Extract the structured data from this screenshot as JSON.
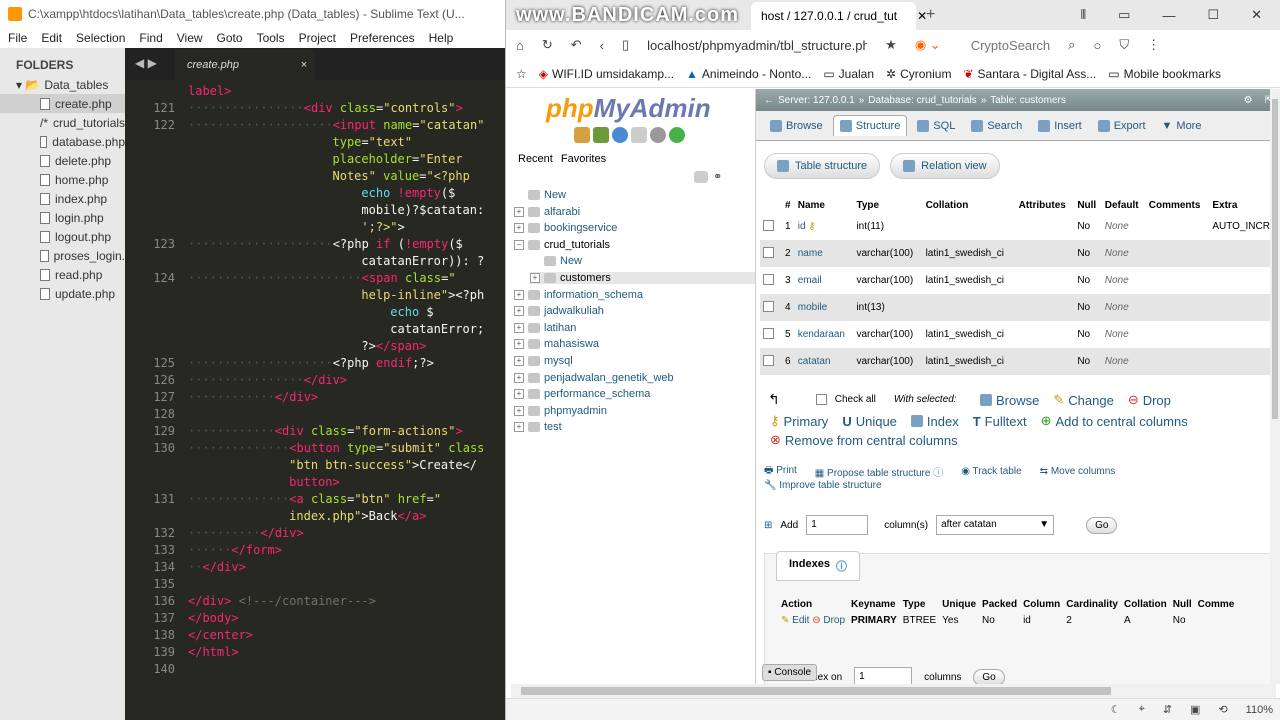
{
  "sublime": {
    "title": "C:\\xampp\\htdocs\\latihan\\Data_tables\\create.php (Data_tables) - Sublime Text (U...",
    "menu": [
      "File",
      "Edit",
      "Selection",
      "Find",
      "View",
      "Goto",
      "Tools",
      "Project",
      "Preferences",
      "Help"
    ],
    "folders_header": "FOLDERS",
    "root_folder": "Data_tables",
    "files": [
      "create.php",
      "crud_tutorials",
      "database.php",
      "delete.php",
      "home.php",
      "index.php",
      "login.php",
      "logout.php",
      "proses_login.",
      "read.php",
      "update.php"
    ],
    "tab_name": "create.php",
    "tab_close": "×",
    "code": [
      {
        "n": "",
        "t": "<span class=tg>label></span>"
      },
      {
        "n": "121",
        "t": "················<span class=tg>&lt;div</span> <span class=at>class</span>=<span class=st>\"controls\"</span><span class=tg>&gt;</span>"
      },
      {
        "n": "122",
        "t": "····················<span class=tg>&lt;input</span> <span class=at>name</span>=<span class=st>\"catatan\"</span>"
      },
      {
        "n": "",
        "t": "                    <span class=at>type</span>=<span class=st>\"text\"</span>"
      },
      {
        "n": "",
        "t": "                    <span class=at>placeholder</span>=<span class=st>\"Enter</span>"
      },
      {
        "n": "",
        "t": "                    <span class=st>Notes\"</span> <span class=at>value</span>=<span class=st>\"&lt;?php</span>"
      },
      {
        "n": "",
        "t": "                        <span class=kw>echo</span> <span class=tg>!empty</span>($"
      },
      {
        "n": "",
        "t": "                        mobile)?$catatan:"
      },
      {
        "n": "",
        "t": "                        <span class=st>';?&gt;\"</span>&gt;"
      },
      {
        "n": "123",
        "t": "····················&lt;?php <span class=tg>if</span> (<span class=tg>!empty</span>($"
      },
      {
        "n": "",
        "t": "                        catatanError)): ?"
      },
      {
        "n": "124",
        "t": "························<span class=tg>&lt;span</span> <span class=at>class</span>=<span class=st>\"</span>"
      },
      {
        "n": "",
        "t": "                        <span class=st>help-inline\"</span>&gt;&lt;?ph"
      },
      {
        "n": "",
        "t": "                            <span class=kw>echo</span> $"
      },
      {
        "n": "",
        "t": "                            catatanError;"
      },
      {
        "n": "",
        "t": "                        ?&gt;<span class=tg>&lt;/span&gt;</span>"
      },
      {
        "n": "125",
        "t": "····················&lt;?php <span class=tg>endif</span>;?&gt;"
      },
      {
        "n": "126",
        "t": "················<span class=tg>&lt;/div&gt;</span>"
      },
      {
        "n": "127",
        "t": "············<span class=tg>&lt;/div&gt;</span>"
      },
      {
        "n": "128",
        "t": ""
      },
      {
        "n": "129",
        "t": "············<span class=tg>&lt;div</span> <span class=at>class</span>=<span class=st>\"form-actions\"</span><span class=tg>&gt;</span>"
      },
      {
        "n": "130",
        "t": "··············<span class=tg>&lt;button</span> <span class=at>type</span>=<span class=st>\"submit\"</span> <span class=at>class</span>"
      },
      {
        "n": "",
        "t": "              <span class=st>\"btn btn-success\"</span>&gt;Create&lt;/"
      },
      {
        "n": "",
        "t": "              <span class=tg>button&gt;</span>"
      },
      {
        "n": "131",
        "t": "··············<span class=tg>&lt;a</span> <span class=at>class</span>=<span class=st>\"btn\"</span> <span class=at>href</span>=<span class=st>\"</span>"
      },
      {
        "n": "",
        "t": "              <span class=st>index.php\"</span>&gt;Back<span class=tg>&lt;/a&gt;</span>"
      },
      {
        "n": "132",
        "t": "··········<span class=tg>&lt;/div&gt;</span>"
      },
      {
        "n": "133",
        "t": "······<span class=tg>&lt;/form&gt;</span>"
      },
      {
        "n": "134",
        "t": "··<span class=tg>&lt;/div&gt;</span>"
      },
      {
        "n": "135",
        "t": ""
      },
      {
        "n": "136",
        "t": "<span class=tg>&lt;/div&gt;</span> <span class=cm>&lt;!---/container---&gt;</span>"
      },
      {
        "n": "137",
        "t": "<span class=tg>&lt;/body&gt;</span>"
      },
      {
        "n": "138",
        "t": "<span class=tg>&lt;/center&gt;</span>"
      },
      {
        "n": "139",
        "t": "<span class=tg>&lt;/html&gt;</span>"
      },
      {
        "n": "140",
        "t": ""
      }
    ]
  },
  "browser": {
    "watermark": "www.BANDICAM.com",
    "tab_title": "host / 127.0.0.1 / crud_tut",
    "tab_close": "✕",
    "new_tab": "+",
    "address": "localhost/phpmyadmin/tbl_structure.ph",
    "search_engine": "CryptoSearch",
    "bookmarks": [
      "WIFI.ID umsidakamp...",
      "Animeindo - Nonto...",
      "Jualan",
      "Cyronium",
      "Santara - Digital Ass...",
      "Mobile bookmarks"
    ],
    "zoom": "110%"
  },
  "pma": {
    "logo_php": "php",
    "logo_admin": "MyAdmin",
    "recent": "Recent",
    "favorites": "Favorites",
    "databases": [
      "New",
      "alfarabi",
      "bookingservice",
      "crud_tutorials",
      "New",
      "customers",
      "information_schema",
      "jadwalkuliah",
      "latihan",
      "mahasiswa",
      "mysql",
      "penjadwalan_genetik_web",
      "performance_schema",
      "phpmyadmin",
      "test"
    ],
    "breadcrumb": {
      "server": "Server: 127.0.0.1",
      "database": "Database: crud_tutorials",
      "table": "Table: customers"
    },
    "tabs": [
      "Browse",
      "Structure",
      "SQL",
      "Search",
      "Insert",
      "Export",
      "More"
    ],
    "subtabs": [
      "Table structure",
      "Relation view"
    ],
    "columns": [
      "#",
      "Name",
      "Type",
      "Collation",
      "Attributes",
      "Null",
      "Default",
      "Comments",
      "Extra"
    ],
    "rows": [
      {
        "num": "1",
        "name": "id",
        "type": "int(11)",
        "collation": "",
        "null": "No",
        "default": "None",
        "extra": "AUTO_INCREI"
      },
      {
        "num": "2",
        "name": "name",
        "type": "varchar(100)",
        "collation": "latin1_swedish_ci",
        "null": "No",
        "default": "None",
        "extra": ""
      },
      {
        "num": "3",
        "name": "email",
        "type": "varchar(100)",
        "collation": "latin1_swedish_ci",
        "null": "No",
        "default": "None",
        "extra": ""
      },
      {
        "num": "4",
        "name": "mobile",
        "type": "int(13)",
        "collation": "",
        "null": "No",
        "default": "None",
        "extra": ""
      },
      {
        "num": "5",
        "name": "kendaraan",
        "type": "varchar(100)",
        "collation": "latin1_swedish_ci",
        "null": "No",
        "default": "None",
        "extra": ""
      },
      {
        "num": "6",
        "name": "catatan",
        "type": "varchar(100)",
        "collation": "latin1_swedish_ci",
        "null": "No",
        "default": "None",
        "extra": ""
      }
    ],
    "check_all": "Check all",
    "with_selected": "With selected:",
    "bulk": [
      "Browse",
      "Change",
      "Drop",
      "Primary",
      "Unique",
      "Index",
      "Fulltext",
      "Add to central columns",
      "Remove from central columns"
    ],
    "tools": [
      "Print",
      "Propose table structure",
      "Track table",
      "Move columns"
    ],
    "improve": "Improve table structure",
    "add_label": "Add",
    "add_value": "1",
    "columns_label": "column(s)",
    "after_select": "after catatan",
    "go": "Go",
    "indexes": "Indexes",
    "index_columns": [
      "Action",
      "Keyname",
      "Type",
      "Unique",
      "Packed",
      "Column",
      "Cardinality",
      "Collation",
      "Null",
      "Comme"
    ],
    "index_row": {
      "edit": "Edit",
      "drop": "Drop",
      "keyname": "PRIMARY",
      "type": "BTREE",
      "unique": "Yes",
      "packed": "No",
      "column": "id",
      "cardinality": "2",
      "collation": "A",
      "null": "No"
    },
    "console": "Console",
    "create_index": "n index on",
    "create_value": "1",
    "create_cols": "columns",
    "create_go": "Go"
  }
}
